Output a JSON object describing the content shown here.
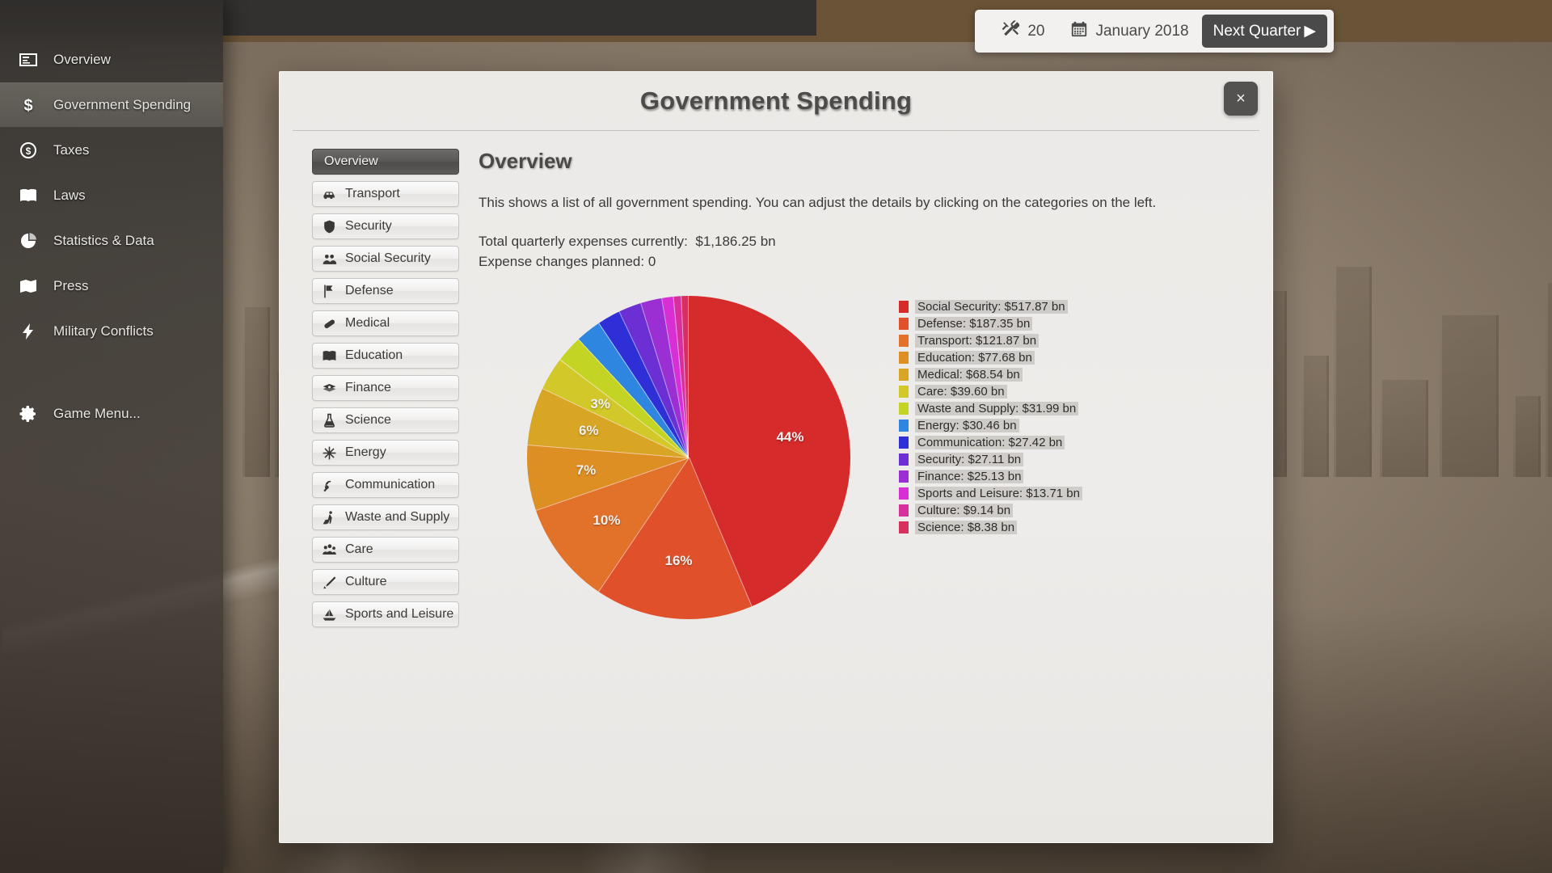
{
  "hud": {
    "tools_icon": "tools-icon",
    "tools_value": "20",
    "calendar_icon": "calendar-icon",
    "date": "January 2018",
    "next_quarter_label": "Next Quarter",
    "next_quarter_arrow": "▶"
  },
  "sidebar": {
    "items": [
      {
        "label": "Overview",
        "icon": "overview-icon",
        "active": false
      },
      {
        "label": "Government Spending",
        "icon": "dollar-icon",
        "active": true
      },
      {
        "label": "Taxes",
        "icon": "coin-icon",
        "active": false
      },
      {
        "label": "Laws",
        "icon": "book-icon",
        "active": false
      },
      {
        "label": "Statistics & Data",
        "icon": "piechart-icon",
        "active": false
      },
      {
        "label": "Press",
        "icon": "newspaper-icon",
        "active": false
      },
      {
        "label": "Military Conflicts",
        "icon": "bolt-icon",
        "active": false
      }
    ],
    "game_menu": {
      "label": "Game Menu...",
      "icon": "gear-icon"
    }
  },
  "dialog": {
    "title": "Government Spending",
    "close_label": "×",
    "tabs": [
      {
        "label": "Overview",
        "icon": "",
        "active": true
      },
      {
        "label": "Transport",
        "icon": "car-icon",
        "active": false
      },
      {
        "label": "Security",
        "icon": "shield-icon",
        "active": false
      },
      {
        "label": "Social Security",
        "icon": "people-icon",
        "active": false
      },
      {
        "label": "Defense",
        "icon": "flag-icon",
        "active": false
      },
      {
        "label": "Medical",
        "icon": "pill-icon",
        "active": false
      },
      {
        "label": "Education",
        "icon": "book-icon",
        "active": false
      },
      {
        "label": "Finance",
        "icon": "money-icon",
        "active": false
      },
      {
        "label": "Science",
        "icon": "flask-icon",
        "active": false
      },
      {
        "label": "Energy",
        "icon": "energy-icon",
        "active": false
      },
      {
        "label": "Communication",
        "icon": "satellite-icon",
        "active": false
      },
      {
        "label": "Waste and Supply",
        "icon": "worker-icon",
        "active": false
      },
      {
        "label": "Care",
        "icon": "family-icon",
        "active": false
      },
      {
        "label": "Culture",
        "icon": "pen-icon",
        "active": false
      },
      {
        "label": "Sports and Leisure",
        "icon": "sailboat-icon",
        "active": false
      }
    ],
    "content": {
      "heading": "Overview",
      "description": "This shows a list of all government spending. You can adjust the details by clicking on the categories on the left.",
      "total_label": "Total quarterly expenses currently:",
      "total_value": "$1,186.25 bn",
      "changes_label": "Expense changes planned:",
      "changes_value": "0"
    }
  },
  "chart_data": {
    "type": "pie",
    "title": "Government Spending Overview",
    "unit": "bn",
    "currency": "$",
    "total": 1186.25,
    "legend_position": "right",
    "start_angle_deg": 0,
    "direction": "clockwise",
    "categories": [
      "Social Security",
      "Defense",
      "Transport",
      "Education",
      "Medical",
      "Care",
      "Waste and Supply",
      "Energy",
      "Communication",
      "Security",
      "Finance",
      "Sports and Leisure",
      "Culture",
      "Science"
    ],
    "values": [
      517.87,
      187.35,
      121.87,
      77.68,
      68.54,
      39.6,
      31.99,
      30.46,
      27.42,
      27.11,
      25.13,
      13.71,
      9.14,
      8.38
    ],
    "value_labels": [
      "$517.87 bn",
      "$187.35 bn",
      "$121.87 bn",
      "$77.68 bn",
      "$68.54 bn",
      "$39.60 bn",
      "$31.99 bn",
      "$30.46 bn",
      "$27.42 bn",
      "$27.11 bn",
      "$25.13 bn",
      "$13.71 bn",
      "$9.14 bn",
      "$8.38 bn"
    ],
    "colors": [
      "#d62b2b",
      "#e0512b",
      "#e2712a",
      "#dd8f24",
      "#d9a524",
      "#d2c82a",
      "#c4d424",
      "#2f86e0",
      "#2f2fd8",
      "#6b2fd4",
      "#9b2fd4",
      "#d72fd4",
      "#d72f9b",
      "#d72f5e"
    ],
    "percent_labels": [
      {
        "category": "Social Security",
        "text": "44%"
      },
      {
        "category": "Defense",
        "text": "16%"
      },
      {
        "category": "Transport",
        "text": "10%"
      },
      {
        "category": "Education",
        "text": "7%"
      },
      {
        "category": "Medical",
        "text": "6%"
      },
      {
        "category": "Care",
        "text": "3%"
      }
    ],
    "legend_entries": [
      {
        "label": "Social Security: ",
        "value": "$517.87 bn",
        "color": "#d62b2b"
      },
      {
        "label": "Defense: ",
        "value": "$187.35 bn",
        "color": "#e0512b"
      },
      {
        "label": "Transport: ",
        "value": "$121.87 bn",
        "color": "#e2712a"
      },
      {
        "label": "Education: ",
        "value": "$77.68 bn",
        "color": "#dd8f24"
      },
      {
        "label": "Medical: ",
        "value": "$68.54 bn",
        "color": "#d9a524"
      },
      {
        "label": "Care: ",
        "value": "$39.60 bn",
        "color": "#d2c82a"
      },
      {
        "label": "Waste and Supply: ",
        "value": "$31.99 bn",
        "color": "#c4d424"
      },
      {
        "label": "Energy: ",
        "value": "$30.46 bn",
        "color": "#2f86e0"
      },
      {
        "label": "Communication: ",
        "value": "$27.42 bn",
        "color": "#2f2fd8"
      },
      {
        "label": "Security: ",
        "value": "$27.11 bn",
        "color": "#6b2fd4"
      },
      {
        "label": "Finance: ",
        "value": "$25.13 bn",
        "color": "#9b2fd4"
      },
      {
        "label": "Sports and Leisure: ",
        "value": "$13.71 bn",
        "color": "#d72fd4"
      },
      {
        "label": "Culture: ",
        "value": "$9.14 bn",
        "color": "#d72f9b"
      },
      {
        "label": "Science: ",
        "value": "$8.38 bn",
        "color": "#d72f5e"
      }
    ]
  }
}
